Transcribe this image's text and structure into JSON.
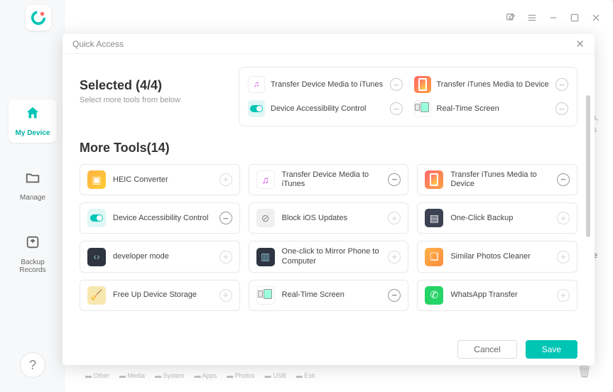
{
  "topbar": {},
  "sidebar": {
    "items": [
      {
        "label": "My Device"
      },
      {
        "label": "Manage"
      },
      {
        "label": "Backup Records"
      }
    ]
  },
  "dialog": {
    "title": "Quick Access",
    "selected_title": "Selected (4/4)",
    "selected_sub": "Select more tools from below",
    "selected": [
      {
        "label": "Transfer Device Media to iTunes"
      },
      {
        "label": "Transfer iTunes Media to Device"
      },
      {
        "label": "Device Accessibility Control"
      },
      {
        "label": "Real-Time Screen"
      }
    ],
    "more_title": "More Tools(14)",
    "tools": [
      {
        "label": "HEIC Converter",
        "icon": "heic",
        "action": "plus"
      },
      {
        "label": "Transfer Device Media to iTunes",
        "icon": "itunes",
        "action": "minus"
      },
      {
        "label": "Transfer iTunes Media to Device",
        "icon": "phone",
        "action": "minus"
      },
      {
        "label": "Device Accessibility Control",
        "icon": "toggle",
        "action": "minus"
      },
      {
        "label": "Block iOS Updates",
        "icon": "block",
        "action": "plus"
      },
      {
        "label": "One-Click Backup",
        "icon": "backup",
        "action": "plus"
      },
      {
        "label": "developer mode",
        "icon": "dev",
        "action": "plus"
      },
      {
        "label": "One-click to Mirror Phone to Computer",
        "icon": "mirror",
        "action": "plus"
      },
      {
        "label": "Similar Photos Cleaner",
        "icon": "similar",
        "action": "plus"
      },
      {
        "label": "Free Up Device Storage",
        "icon": "free",
        "action": "plus"
      },
      {
        "label": "Real-Time Screen",
        "icon": "rts",
        "action": "minus"
      },
      {
        "label": "WhatsApp Transfer",
        "icon": "wa",
        "action": "plus"
      }
    ],
    "cancel": "Cancel",
    "save": "Save"
  },
  "bg": {
    "line1": "apps,",
    "line2": "apps",
    "device_suffix": "/ice",
    "tabs": [
      "Other",
      "Media",
      "System",
      "Apps",
      "Photos",
      "USB",
      "Exit"
    ]
  }
}
